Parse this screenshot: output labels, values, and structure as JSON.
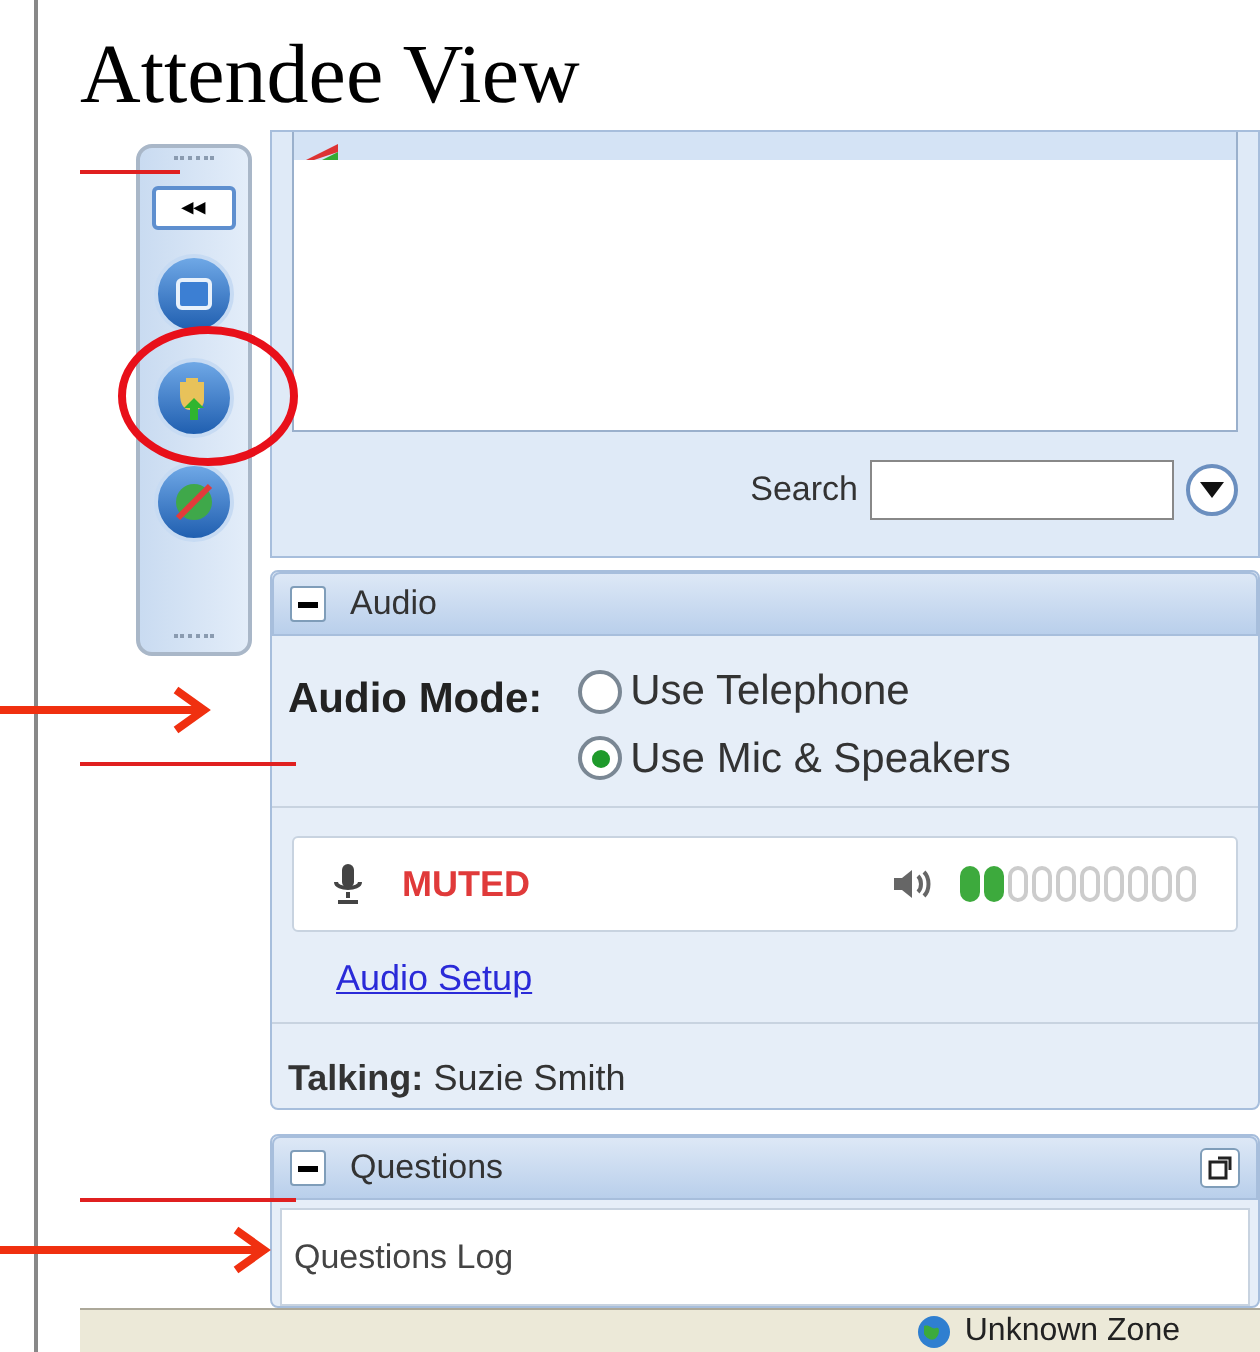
{
  "slide_title": "Attendee View",
  "toolbar": {
    "collapse_label": "◂◂"
  },
  "participants": {
    "search_label": "Search"
  },
  "audio": {
    "header": "Audio",
    "expanded": true,
    "mode_label": "Audio Mode:",
    "options": [
      {
        "label": "Use Telephone",
        "selected": false
      },
      {
        "label": "Use Mic & Speakers",
        "selected": true
      }
    ],
    "mic_status": "MUTED",
    "muted": true,
    "level": 0.2,
    "setup_link": "Audio Setup",
    "talking_label": "Talking:",
    "talking_name": "Suzie Smith"
  },
  "questions": {
    "header": "Questions",
    "expanded": true,
    "log_label": "Questions Log"
  },
  "status_bar": {
    "zone": "Unknown Zone"
  }
}
